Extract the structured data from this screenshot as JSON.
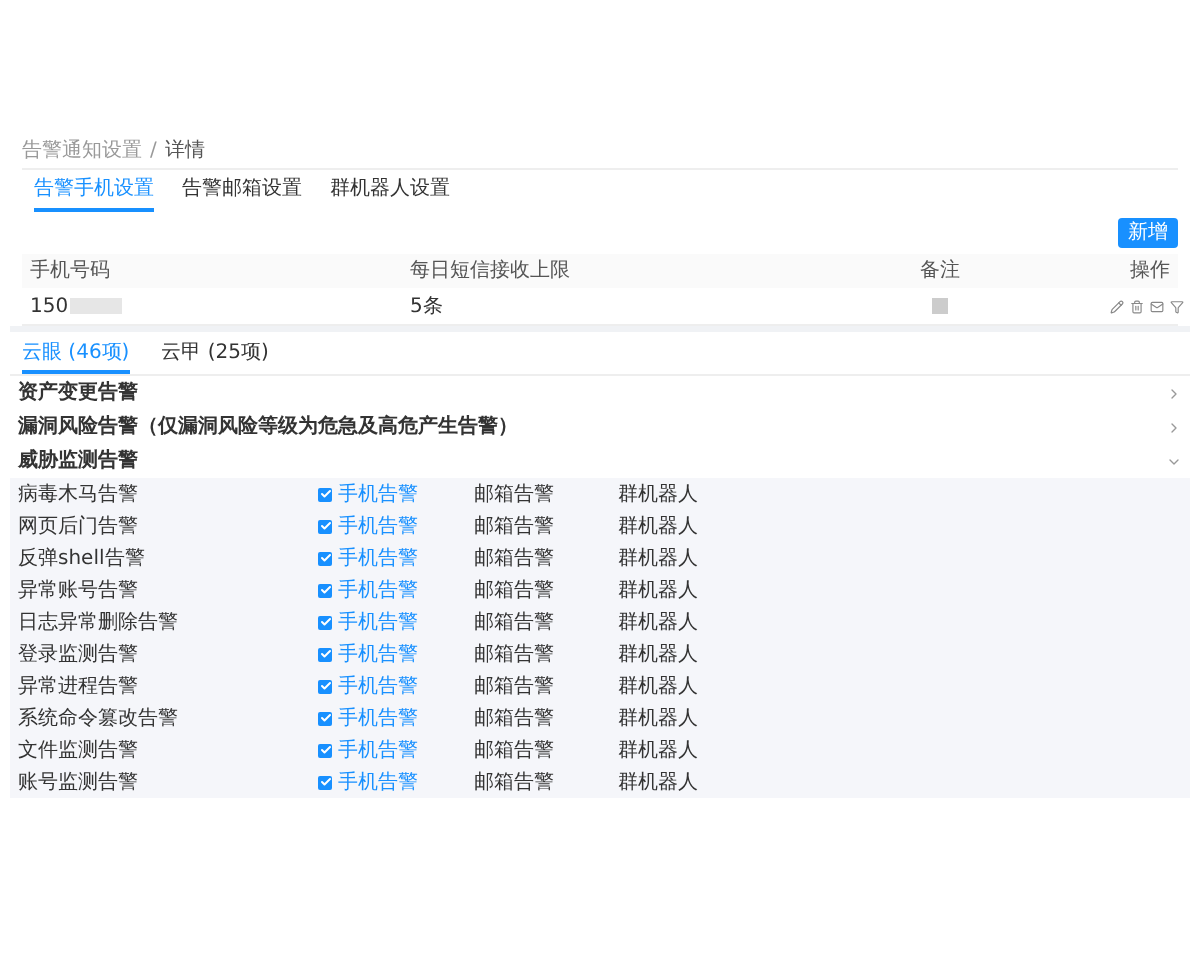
{
  "breadcrumb_separator": "/",
  "breadcrumb": [
    {
      "label": "告警通知设置",
      "current": false
    },
    {
      "label": "详情",
      "current": true
    }
  ],
  "tabs": [
    {
      "label": "告警手机设置",
      "selected": true
    },
    {
      "label": "告警邮箱设置",
      "selected": false
    },
    {
      "label": "群机器人设置",
      "selected": false
    }
  ],
  "add_button": "新增",
  "table": {
    "columns": [
      "手机号码",
      "每日短信接收上限",
      "备注",
      "操作"
    ],
    "rows": [
      {
        "phone": "150",
        "limit": "5条"
      }
    ]
  },
  "sub_tabs": [
    {
      "label": "云眼 (46项)",
      "selected": true
    },
    {
      "label": "云甲 (25项)",
      "selected": false
    }
  ],
  "sections": [
    {
      "title": "资产变更告警",
      "expanded": false
    },
    {
      "title": "漏洞风险告警（仅漏洞风险等级为危急及高危产生告警）",
      "expanded": false
    },
    {
      "title": "威胁监测告警",
      "expanded": true
    }
  ],
  "alerts": [
    {
      "name": "病毒木马告警",
      "phone": {
        "label": "手机告警",
        "checked": true
      },
      "email": "邮箱告警",
      "robot": "群机器人"
    },
    {
      "name": "网页后门告警",
      "phone": {
        "label": "手机告警",
        "checked": true
      },
      "email": "邮箱告警",
      "robot": "群机器人"
    },
    {
      "name": "反弹shell告警",
      "phone": {
        "label": "手机告警",
        "checked": true
      },
      "email": "邮箱告警",
      "robot": "群机器人"
    },
    {
      "name": "异常账号告警",
      "phone": {
        "label": "手机告警",
        "checked": true
      },
      "email": "邮箱告警",
      "robot": "群机器人"
    },
    {
      "name": "日志异常删除告警",
      "phone": {
        "label": "手机告警",
        "checked": true
      },
      "email": "邮箱告警",
      "robot": "群机器人"
    },
    {
      "name": "登录监测告警",
      "phone": {
        "label": "手机告警",
        "checked": true
      },
      "email": "邮箱告警",
      "robot": "群机器人"
    },
    {
      "name": "异常进程告警",
      "phone": {
        "label": "手机告警",
        "checked": true
      },
      "email": "邮箱告警",
      "robot": "群机器人"
    },
    {
      "name": "系统命令篡改告警",
      "phone": {
        "label": "手机告警",
        "checked": true
      },
      "email": "邮箱告警",
      "robot": "群机器人"
    },
    {
      "name": "文件监测告警",
      "phone": {
        "label": "手机告警",
        "checked": true
      },
      "email": "邮箱告警",
      "robot": "群机器人"
    },
    {
      "name": "账号监测告警",
      "phone": {
        "label": "手机告警",
        "checked": true
      },
      "email": "邮箱告警",
      "robot": "群机器人"
    }
  ]
}
